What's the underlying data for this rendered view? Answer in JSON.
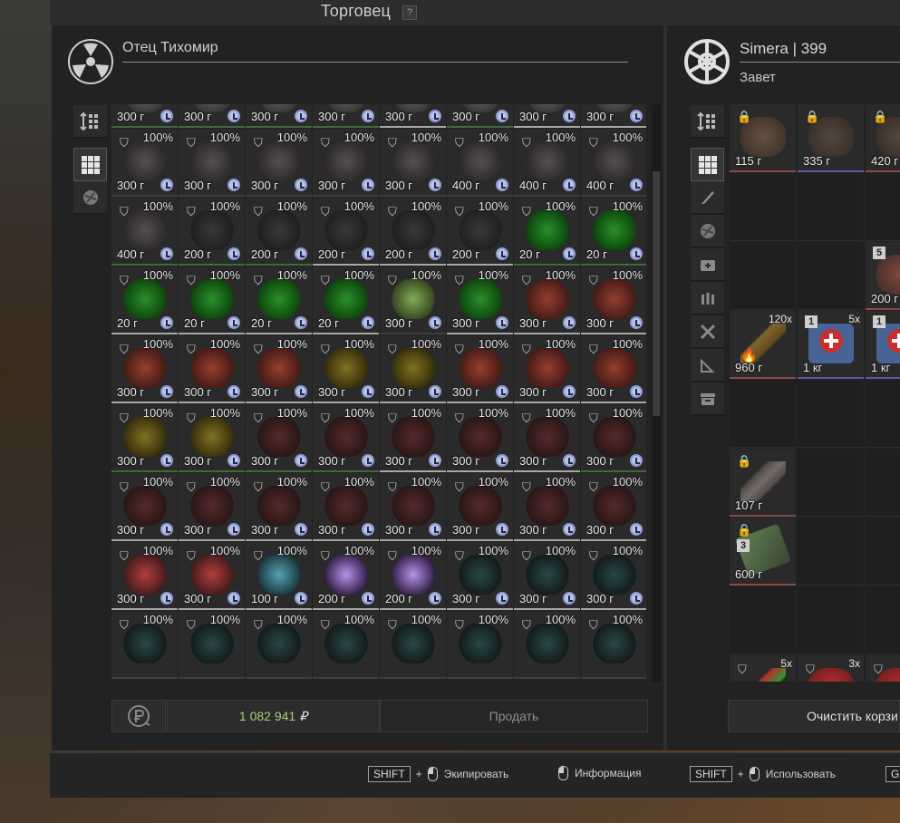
{
  "window": {
    "title": "Торговец",
    "help": "?"
  },
  "trader": {
    "name": "Отец Тихомир"
  },
  "player": {
    "name": "Simera | 399",
    "subtitle": "Завет"
  },
  "trader_grid": {
    "rows": [
      [
        [
          "300 г",
          "",
          "g"
        ],
        [
          "300 г",
          "",
          "g"
        ],
        [
          "300 г",
          "",
          "g"
        ],
        [
          "300 г",
          "",
          "g"
        ],
        [
          "300 г",
          "",
          "w"
        ],
        [
          "300 г",
          "",
          "g"
        ],
        [
          "300 г",
          "",
          "w"
        ],
        [
          "300 г",
          "",
          "w"
        ]
      ],
      [
        [
          "300 г",
          "100%",
          ""
        ],
        [
          "300 г",
          "100%",
          ""
        ],
        [
          "300 г",
          "100%",
          ""
        ],
        [
          "300 г",
          "100%",
          ""
        ],
        [
          "300 г",
          "100%",
          ""
        ],
        [
          "400 г",
          "100%",
          ""
        ],
        [
          "400 г",
          "100%",
          ""
        ],
        [
          "400 г",
          "100%",
          ""
        ]
      ],
      [
        [
          "400 г",
          "100%",
          "g"
        ],
        [
          "200 г",
          "100%",
          "g"
        ],
        [
          "200 г",
          "100%",
          "g"
        ],
        [
          "200 г",
          "100%",
          "w"
        ],
        [
          "200 г",
          "100%",
          "w"
        ],
        [
          "200 г",
          "100%",
          "w"
        ],
        [
          "20 г",
          "100%",
          "g"
        ],
        [
          "20 г",
          "100%",
          "g"
        ]
      ],
      [
        [
          "20 г",
          "100%",
          "w"
        ],
        [
          "20 г",
          "100%",
          "w"
        ],
        [
          "20 г",
          "100%",
          "w"
        ],
        [
          "20 г",
          "100%",
          "w"
        ],
        [
          "300 г",
          "100%",
          ""
        ],
        [
          "300 г",
          "100%",
          "w"
        ],
        [
          "300 г",
          "100%",
          "w"
        ],
        [
          "300 г",
          "100%",
          "w"
        ]
      ],
      [
        [
          "300 г",
          "100%",
          "w"
        ],
        [
          "300 г",
          "100%",
          "w"
        ],
        [
          "300 г",
          "100%",
          "w"
        ],
        [
          "300 г",
          "100%",
          "w"
        ],
        [
          "300 г",
          "100%",
          "w"
        ],
        [
          "300 г",
          "100%",
          "w"
        ],
        [
          "300 г",
          "100%",
          "w"
        ],
        [
          "300 г",
          "100%",
          "w"
        ]
      ],
      [
        [
          "300 г",
          "100%",
          "g"
        ],
        [
          "300 г",
          "100%",
          "g"
        ],
        [
          "300 г",
          "100%",
          "g"
        ],
        [
          "300 г",
          "100%",
          "g"
        ],
        [
          "300 г",
          "100%",
          "w"
        ],
        [
          "300 г",
          "100%",
          "w"
        ],
        [
          "300 г",
          "100%",
          "w"
        ],
        [
          "300 г",
          "100%",
          "g"
        ]
      ],
      [
        [
          "300 г",
          "100%",
          "w"
        ],
        [
          "300 г",
          "100%",
          "w"
        ],
        [
          "300 г",
          "100%",
          "w"
        ],
        [
          "300 г",
          "100%",
          "w"
        ],
        [
          "300 г",
          "100%",
          "w"
        ],
        [
          "300 г",
          "100%",
          "w"
        ],
        [
          "300 г",
          "100%",
          "w"
        ],
        [
          "300 г",
          "100%",
          "w"
        ]
      ],
      [
        [
          "300 г",
          "100%",
          "w"
        ],
        [
          "300 г",
          "100%",
          "w"
        ],
        [
          "100 г",
          "100%",
          "w"
        ],
        [
          "200 г",
          "100%",
          "w"
        ],
        [
          "200 г",
          "100%",
          "w"
        ],
        [
          "300 г",
          "100%",
          "w"
        ],
        [
          "300 г",
          "100%",
          "w"
        ],
        [
          "300 г",
          "100%",
          "w"
        ]
      ],
      [
        [
          "",
          "100%",
          ""
        ],
        [
          "",
          "100%",
          ""
        ],
        [
          "",
          "100%",
          ""
        ],
        [
          "",
          "100%",
          ""
        ],
        [
          "",
          "100%",
          ""
        ],
        [
          "",
          "100%",
          ""
        ],
        [
          "",
          "100%",
          ""
        ],
        [
          "",
          "100%",
          ""
        ]
      ]
    ]
  },
  "player_grid": {
    "row0": [
      "115 г",
      "335 г",
      "420 г"
    ],
    "row2_col2": {
      "price": "200 г",
      "level": "5"
    },
    "row3": [
      {
        "price": "960 г",
        "stack": "120x"
      },
      {
        "price": "1 кг",
        "stack": "5x",
        "level": "1"
      },
      {
        "price": "1 кг",
        "level": "1"
      }
    ],
    "row5": {
      "price": "107 г"
    },
    "row6": {
      "price": "600 г",
      "level": "3"
    },
    "row8": [
      {
        "stack": "5x"
      },
      {
        "stack": "3x"
      },
      {
        "stack": ""
      }
    ]
  },
  "money": {
    "value": "1 082 941",
    "currency": "₽"
  },
  "buttons": {
    "sell": "Продать",
    "clear": "Очистить корзи"
  },
  "hints": {
    "equip": {
      "key": "SHIFT",
      "plus": "+",
      "label": "Экипировать"
    },
    "info": {
      "label": "Информация"
    },
    "use": {
      "key": "SHIFT",
      "plus": "+",
      "label": "Использовать"
    },
    "extra": {
      "key": "G"
    }
  }
}
